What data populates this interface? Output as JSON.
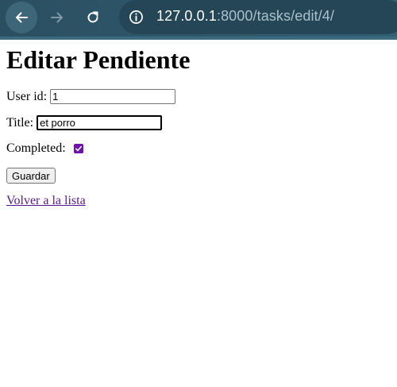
{
  "browser": {
    "url_host": "127.0.0.1",
    "url_rest": ":8000/tasks/edit/4/",
    "icons": {
      "back": "back-arrow-icon",
      "forward": "forward-arrow-icon",
      "reload": "reload-icon",
      "info": "info-icon"
    }
  },
  "page": {
    "title": "Editar Pendiente",
    "form": {
      "user_id_label": "User id:",
      "user_id_value": "1",
      "title_label": "Title:",
      "title_value": "et porro",
      "completed_label": "Completed:",
      "completed_checked": true,
      "submit_label": "Guardar"
    },
    "back_link": "Volver a la lista"
  },
  "colors": {
    "toolbar": "#2f5a6d",
    "checkbox_accent": "#6e12a8",
    "visited_link": "#551a8b"
  }
}
